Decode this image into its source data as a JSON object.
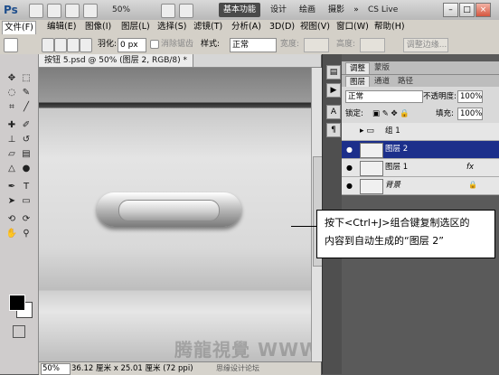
{
  "app": {
    "logo": "Ps",
    "zoom": "50%",
    "workspaces": [
      "基本功能",
      "设计",
      "绘画",
      "摄影",
      "»"
    ],
    "cs_live": "CS Live",
    "window_controls": [
      "–",
      "□",
      "×"
    ]
  },
  "menu": [
    "文件(F)",
    "编辑(E)",
    "图像(I)",
    "图层(L)",
    "选择(S)",
    "滤镜(T)",
    "分析(A)",
    "3D(D)",
    "视图(V)",
    "窗口(W)",
    "帮助(H)"
  ],
  "options": {
    "feather_label": "羽化:",
    "feather_value": "0 px",
    "antialias_label": "消除锯齿",
    "style_label": "样式:",
    "style_value": "正常",
    "width_label": "宽度:",
    "height_label": "高度:",
    "refine_button": "调整边缘..."
  },
  "document": {
    "tab_title": "按钮 5.psd @ 50% (图层 2, RGB/8) *",
    "status_zoom": "50%",
    "status_doc": "36.12 厘米 x 25.01 厘米 (72 ppi)",
    "status_forum": "思缘设计论坛",
    "watermark": "腾龍視覺 WWW.TLVI.NET",
    "watermark_small": "WWW.MISSYUAN.COM"
  },
  "panels": {
    "top_tabs": [
      "调整",
      "蒙版"
    ],
    "layer_tabs": [
      "图层",
      "通道",
      "路径"
    ],
    "blend_mode": "正常",
    "opacity_label": "不透明度:",
    "opacity_value": "100%",
    "lock_label": "锁定:",
    "fill_label": "填充:",
    "fill_value": "100%",
    "layers": [
      {
        "name": "组 1",
        "type": "group",
        "selected": false,
        "fx": ""
      },
      {
        "name": "图层 2",
        "type": "layer",
        "selected": true,
        "fx": ""
      },
      {
        "name": "图层 1",
        "type": "layer",
        "selected": false,
        "fx": "fx"
      },
      {
        "name": "背景",
        "type": "background",
        "selected": false,
        "fx": ""
      }
    ]
  },
  "callout": {
    "line1": "按下<Ctrl+J>组合键复制选区的",
    "line2": "内容到自动生成的“图层 2”"
  },
  "colors": {
    "selected_layer": "#1c2f8b",
    "foreground": "#000000",
    "background": "#ffffff"
  }
}
